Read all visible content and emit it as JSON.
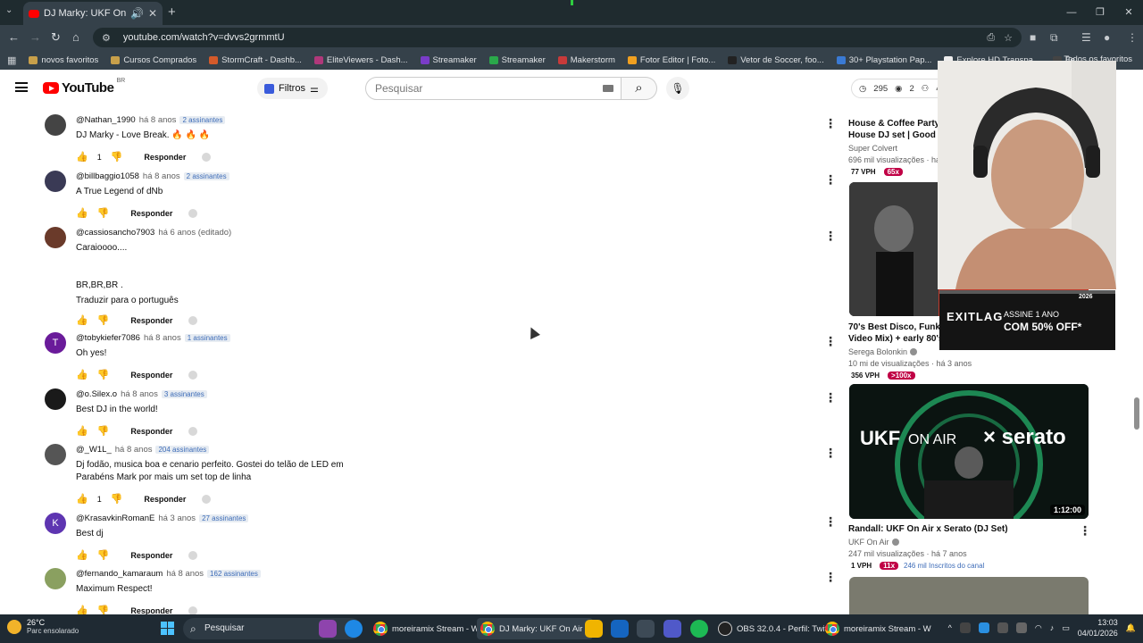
{
  "browser": {
    "active_tab_title": "DJ Marky: UKF On Air x Ser",
    "url": "youtube.com/watch?v=dvvs2grmmtU",
    "bookmarks": [
      {
        "label": "novos favoritos",
        "color": "#c8a04a"
      },
      {
        "label": "Cursos Comprados",
        "color": "#c8a04a"
      },
      {
        "label": "StormCraft - Dashb...",
        "color": "#d45a2a"
      },
      {
        "label": "EliteViewers - Dash...",
        "color": "#b0387a"
      },
      {
        "label": "Streamaker",
        "color": "#7a3cc8"
      },
      {
        "label": "Streamaker",
        "color": "#2aa84a"
      },
      {
        "label": "Makerstorm",
        "color": "#c83a3a"
      },
      {
        "label": "Fotor Editor | Foto...",
        "color": "#f0a020"
      },
      {
        "label": "Vetor de Soccer, foo...",
        "color": "#222222"
      },
      {
        "label": "30+ Playstation Pap...",
        "color": "#3a7ad4"
      },
      {
        "label": "Explore HD Transpa...",
        "color": "#eeeeee"
      },
      {
        "label": "Fe",
        "color": "#444444"
      }
    ],
    "bookmarks_right": "Todos os favoritos"
  },
  "youtube": {
    "logo_text": "YouTube",
    "country_code": "BR",
    "filters_label": "Filtros",
    "search_placeholder": "Pesquisar",
    "stats": {
      "views": "295",
      "watch": "2",
      "users": "47"
    }
  },
  "comments": [
    {
      "user": "@Nathan_1990",
      "time": "há 8 anos",
      "subs": "2 assinantes",
      "text": "DJ Marky - Love Break. 🔥 🔥 🔥",
      "likes": "1",
      "reply": "Responder",
      "avatar_color": "#444444",
      "avatar_letter": ""
    },
    {
      "user": "@billbaggio1058",
      "time": "há 8 anos",
      "subs": "2 assinantes",
      "text": "A True Legend of dNb",
      "likes": "",
      "reply": "Responder",
      "avatar_color": "#3a3a55",
      "avatar_letter": ""
    },
    {
      "user": "@cassiosancho7903",
      "time": "há 6 anos (editado)",
      "subs": "",
      "text": "Caraioooo....\n\n\nBR,BR,BR .",
      "translate": "Traduzir para o português",
      "likes": "",
      "reply": "Responder",
      "avatar_color": "#6a3a2a",
      "avatar_letter": ""
    },
    {
      "user": "@tobykiefer7086",
      "time": "há 8 anos",
      "subs": "1 assinantes",
      "text": "Oh yes!",
      "likes": "",
      "reply": "Responder",
      "avatar_color": "#6a1b9a",
      "avatar_letter": "T"
    },
    {
      "user": "@o.Silex.o",
      "time": "há 8 anos",
      "subs": "3 assinantes",
      "text": "Best DJ in the world!",
      "likes": "",
      "reply": "Responder",
      "avatar_color": "#1a1a1a",
      "avatar_letter": ""
    },
    {
      "user": "@_W1L_",
      "time": "há 8 anos",
      "subs": "204 assinantes",
      "text": "Dj fodão, musica boa e cenario perfeito. Gostei do telão de LED em\nParabéns Mark por mais um set top de linha",
      "likes": "1",
      "reply": "Responder",
      "avatar_color": "#555555",
      "avatar_letter": ""
    },
    {
      "user": "@KrasavkinRomanE",
      "time": "há 3 anos",
      "subs": "27 assinantes",
      "text": "Best dj",
      "likes": "",
      "reply": "Responder",
      "avatar_color": "#5e35b1",
      "avatar_letter": "K"
    },
    {
      "user": "@fernando_kamaraum",
      "time": "há 8 anos",
      "subs": "162 assinantes",
      "text": "Maximum Respect!",
      "likes": "",
      "reply": "Responder",
      "avatar_color": "#8aa060",
      "avatar_letter": ""
    }
  ],
  "sidebar": [
    {
      "title": "House & Coffee Party @\nHouse DJ set | Good vib",
      "channel": "Super Colvert",
      "verified": false,
      "meta": "696 mil visualizações · há 6",
      "vph": "77 VPH",
      "mult": "65x",
      "subs": ""
    },
    {
      "title": "70's Best Disco, Funk &\nVideo Mix) + early 80's |",
      "channel": "Serega Bolonkin",
      "verified": true,
      "meta": "10 mi de visualizações · há 3 anos",
      "vph": "356 VPH",
      "mult": ">100x",
      "subs": ""
    },
    {
      "title": "Randall: UKF On Air x Serato (DJ Set)",
      "channel": "UKF On Air",
      "verified": true,
      "meta": "247 mil visualizações · há 7 anos",
      "vph": "1 VPH",
      "mult": "11x",
      "subs": "246 mil Inscritos do canal",
      "duration": "1:12:00",
      "thumb_text_a": "UKF",
      "thumb_text_b": "ON AIR",
      "thumb_text_c": "× serato"
    }
  ],
  "overlay": {
    "ad_brand": "EXITLAG",
    "ad_line1": "ASSINE 1 ANO",
    "ad_line2": "COM 50% OFF*",
    "ad_year": "2026"
  },
  "taskbar": {
    "weather_temp": "26°C",
    "weather_desc": "Parc ensolarado",
    "search_label": "Pesquisar",
    "tasks": [
      "moreiramix Stream - W",
      "DJ Marky: UKF On Air x",
      "OBS 32.0.4 - Perfil: Twitc",
      "moreiramix Stream - W"
    ],
    "time": "13:03",
    "date": "04/01/2026"
  }
}
